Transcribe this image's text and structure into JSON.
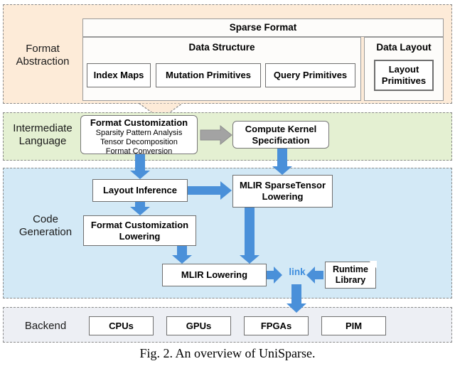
{
  "figure": {
    "caption": "Fig. 2.  An overview of UniSparse."
  },
  "colors": {
    "format_panel_bg": "#fdebd8",
    "ir_panel_bg": "#e4f0d2",
    "codegen_panel_bg": "#d3e9f6",
    "backend_panel_bg": "#edeff4",
    "blue_arrow": "#4a90d9",
    "gray_arrow": "#9a9a9a",
    "link_text": "#3e8ede",
    "box_border": "#6f6f6f"
  },
  "layers": {
    "format_abstraction": {
      "label": "Format\nAbstraction",
      "label_line1": "Format",
      "label_line2": "Abstraction",
      "sparse_format_title": "Sparse Format",
      "data_structure": {
        "title": "Data Structure",
        "items": [
          {
            "label": "Index Maps"
          },
          {
            "label": "Mutation Primitives"
          },
          {
            "label": "Query Primitives"
          }
        ]
      },
      "data_layout": {
        "title": "Data Layout",
        "items": [
          {
            "label": "Layout\nPrimitives",
            "line1": "Layout",
            "line2": "Primitives"
          }
        ]
      }
    },
    "intermediate_language": {
      "label_line1": "Intermediate",
      "label_line2": "Language",
      "format_customization": {
        "title": "Format Customization",
        "subitems": [
          "Sparsity Pattern Analysis",
          "Tensor Decomposition",
          "Format Conversion"
        ]
      },
      "compute_kernel": {
        "line1": "Compute Kernel",
        "line2": "Specification"
      }
    },
    "code_generation": {
      "label_line1": "Code",
      "label_line2": "Generation",
      "boxes": [
        {
          "name": "layout-inference",
          "label": "Layout Inference"
        },
        {
          "name": "mlir-sparsetensor-lowering",
          "line1": "MLIR SparseTensor",
          "line2": "Lowering"
        },
        {
          "name": "format-customization-lowering",
          "line1": "Format Customization",
          "line2": "Lowering"
        },
        {
          "name": "mlir-lowering",
          "label": "MLIR Lowering"
        },
        {
          "name": "runtime-library",
          "line1": "Runtime",
          "line2": "Library"
        }
      ],
      "link_label": "link"
    },
    "backend": {
      "label": "Backend",
      "targets": [
        {
          "label": "CPUs"
        },
        {
          "label": "GPUs"
        },
        {
          "label": "FPGAs"
        },
        {
          "label": "PIM"
        }
      ]
    }
  }
}
